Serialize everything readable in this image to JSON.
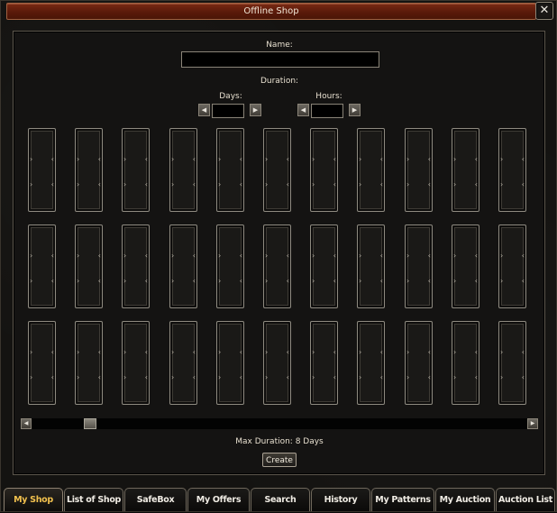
{
  "window": {
    "title": "Offline Shop"
  },
  "close": {
    "symbol": "✕"
  },
  "form": {
    "name_label": "Name:",
    "name_value": "",
    "duration_label": "Duration:",
    "days_label": "Days:",
    "days_value": "",
    "hours_label": "Hours:",
    "hours_value": "",
    "arrow_left": "◀",
    "arrow_right": "▶"
  },
  "grid": {
    "rows": 3,
    "cols": 11
  },
  "scrollbar": {
    "left_arrow": "◀",
    "right_arrow": "▶"
  },
  "footer": {
    "max_duration": "Max Duration: 8 Days",
    "create_label": "Create"
  },
  "tabs": [
    {
      "label": "My Shop",
      "active": true
    },
    {
      "label": "List of Shop",
      "active": false
    },
    {
      "label": "SafeBox",
      "active": false
    },
    {
      "label": "My Offers",
      "active": false
    },
    {
      "label": "Search",
      "active": false
    },
    {
      "label": "History",
      "active": false
    },
    {
      "label": "My Patterns",
      "active": false
    },
    {
      "label": "My Auction",
      "active": false
    },
    {
      "label": "Auction List",
      "active": false
    }
  ],
  "colors": {
    "active_tab": "#f2c14e",
    "title_bar": "#5a1a0a"
  }
}
